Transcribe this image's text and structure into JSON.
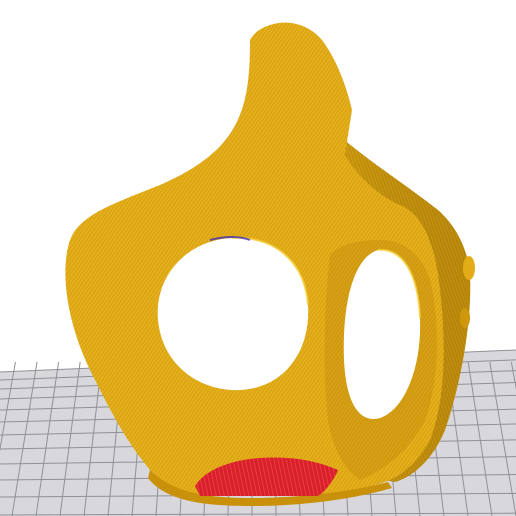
{
  "viewport": {
    "background_color": "#ffffff",
    "grid_fill_color": "#d8d8dc",
    "grid_line_color": "#8f9196",
    "model_color": "#e0a813",
    "model_shade_color": "#b98508",
    "model_highlight_color": "#f4c52d",
    "support_color": "#d91f2a",
    "hole_color": "#ffffff"
  }
}
